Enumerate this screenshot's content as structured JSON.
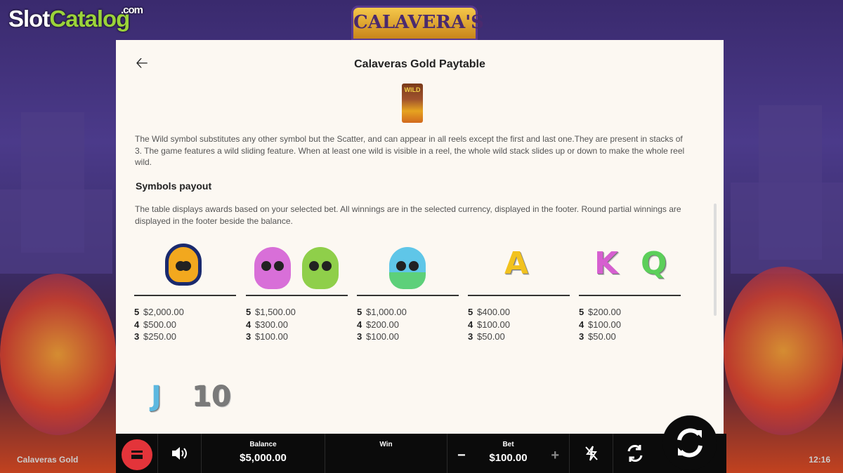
{
  "watermark": {
    "slot": "Slot",
    "catalog": "Catalog",
    "dotcom": ".com"
  },
  "game_logo_text": "CALAVERA'S",
  "paytable": {
    "title": "Calaveras Gold Paytable",
    "wild_label": "WILD",
    "wild_description": "The Wild symbol substitutes any other symbol but the Scatter, and can appear in all reels except the first and last one.They are present in stacks of 3. The game features a wild sliding feature. When at least one wild is visible in a reel, the whole wild stack slides up or down to make the whole reel wild.",
    "section_title": "Symbols payout",
    "section_description": "The table displays awards based on your selected bet. All winnings are in the selected currency, displayed in the footer. Round partial winnings are displayed in the footer beside the balance.",
    "groups": [
      {
        "icons": [
          "orange-skull-woman-icon"
        ],
        "pays": [
          {
            "count": "5",
            "amount": "$2,000.00"
          },
          {
            "count": "4",
            "amount": "$500.00"
          },
          {
            "count": "3",
            "amount": "$250.00"
          }
        ]
      },
      {
        "icons": [
          "pink-skull-icon",
          "green-skull-icon"
        ],
        "pays": [
          {
            "count": "5",
            "amount": "$1,500.00"
          },
          {
            "count": "4",
            "amount": "$300.00"
          },
          {
            "count": "3",
            "amount": "$100.00"
          }
        ]
      },
      {
        "icons": [
          "blue-skull-icon"
        ],
        "pays": [
          {
            "count": "5",
            "amount": "$1,000.00"
          },
          {
            "count": "4",
            "amount": "$200.00"
          },
          {
            "count": "3",
            "amount": "$100.00"
          }
        ]
      },
      {
        "icons": [
          "a-letter-icon"
        ],
        "letters": [
          "A"
        ],
        "pays": [
          {
            "count": "5",
            "amount": "$400.00"
          },
          {
            "count": "4",
            "amount": "$100.00"
          },
          {
            "count": "3",
            "amount": "$50.00"
          }
        ]
      },
      {
        "icons": [
          "k-letter-icon",
          "q-letter-icon"
        ],
        "letters": [
          "K",
          "Q"
        ],
        "pays": [
          {
            "count": "5",
            "amount": "$200.00"
          },
          {
            "count": "4",
            "amount": "$100.00"
          },
          {
            "count": "3",
            "amount": "$50.00"
          }
        ]
      }
    ],
    "partial_row_letters": [
      "J",
      "10"
    ]
  },
  "footer": {
    "game_name": "Calaveras Gold",
    "clock": "12:16",
    "balance_label": "Balance",
    "balance_value": "$5,000.00",
    "win_label": "Win",
    "win_value": "",
    "bet_label": "Bet",
    "bet_value": "$100.00",
    "bet_minus": "−",
    "bet_plus": "+"
  },
  "colors": {
    "accent_red": "#e3343a",
    "panel_bg": "#fcf8f2",
    "bar_bg": "#0b0b0b"
  }
}
